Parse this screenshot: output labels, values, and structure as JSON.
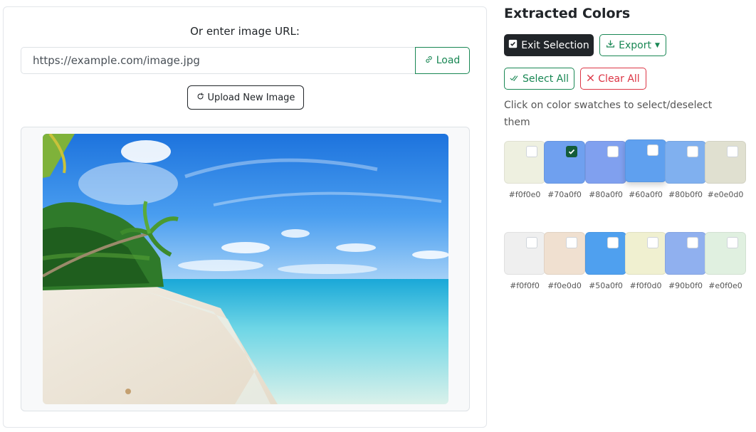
{
  "left": {
    "url_label": "Or enter image URL:",
    "url_value": "https://example.com/image.jpg",
    "load_label": "Load",
    "upload_label": "Upload New Image"
  },
  "right": {
    "heading": "Extracted Colors",
    "exit_label": "Exit Selection",
    "export_label": "Export",
    "select_all_label": "Select All",
    "clear_all_label": "Clear All",
    "hint": "Click on color swatches to select/deselect them"
  },
  "swatches": [
    {
      "hex": "#f0f0e0",
      "color": "#eef0e0",
      "selected": false
    },
    {
      "hex": "#70a0f0",
      "color": "#6fa0ef",
      "selected": true
    },
    {
      "hex": "#80a0f0",
      "color": "#80a0ef",
      "selected": false
    },
    {
      "hex": "#60a0f0",
      "color": "#5fa0ef",
      "selected": false,
      "hover": true
    },
    {
      "hex": "#80b0f0",
      "color": "#80b0ef",
      "selected": false
    },
    {
      "hex": "#e0e0d0",
      "color": "#e0e0d0",
      "selected": false
    },
    {
      "hex": "#f0f0f0",
      "color": "#efefef",
      "selected": false
    },
    {
      "hex": "#f0e0d0",
      "color": "#f0e0d0",
      "selected": false
    },
    {
      "hex": "#50a0f0",
      "color": "#4fa0ef",
      "selected": false
    },
    {
      "hex": "#f0f0d0",
      "color": "#f0f0d0",
      "selected": false
    },
    {
      "hex": "#90b0f0",
      "color": "#90b0ef",
      "selected": false
    },
    {
      "hex": "#e0f0e0",
      "color": "#e0f0e0",
      "selected": false
    }
  ]
}
